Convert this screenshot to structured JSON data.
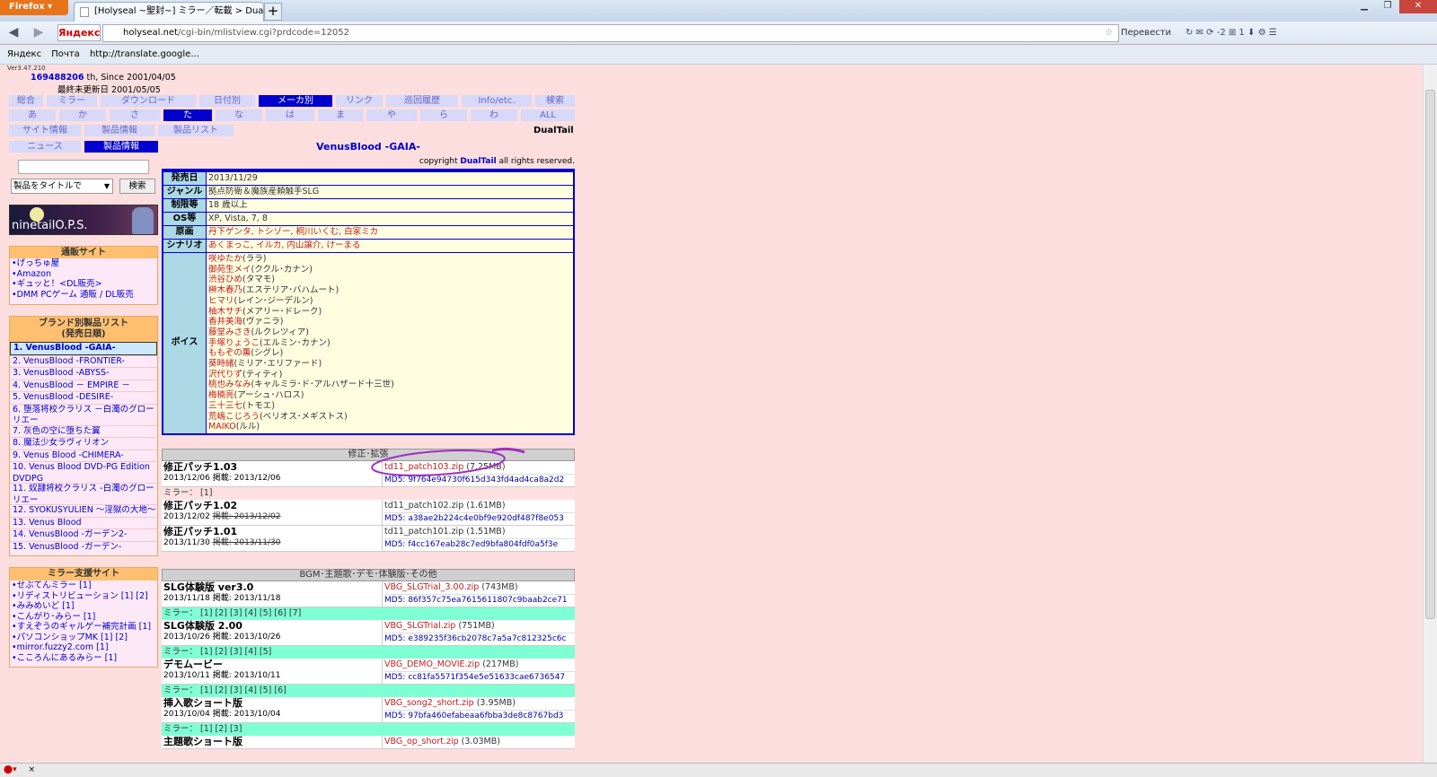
{
  "browser": {
    "app_button": "Firefox",
    "tab_title": "[Holyseal ~聖封~] ミラー／転載 > Dual...",
    "new_tab": "+",
    "yandex_button": "Яндекс",
    "url_domain": "holyseal.net",
    "url_path": "/cgi-bin/mlistview.cgi?prdcode=12052",
    "translate_label": "Перевести",
    "toolbar_counts": "⟳ -2  ⊞ 1",
    "bookmarks": [
      "Яндекс",
      "Почта",
      "http://translate.google..."
    ],
    "status_close": "×"
  },
  "page": {
    "version": "Ver3.47.210",
    "counter": "169488206",
    "counter_suffix": "th, Since 2001/04/05",
    "last_update": "最終未更新日 2001/05/05"
  },
  "menus": {
    "row1": [
      "総合",
      "ミラー",
      "ダウンロード",
      "日付別",
      "メーカ別",
      "リンク",
      "巡回履歴",
      "Info/etc.",
      "検索"
    ],
    "row2": [
      "あ",
      "か",
      "さ",
      "た",
      "な",
      "は",
      "ま",
      "や",
      "ら",
      "わ",
      "ALL"
    ],
    "row3": [
      "サイト情報",
      "製品情報",
      "製品リスト"
    ],
    "row4": [
      "ニュース",
      "製品情報"
    ]
  },
  "brand_name": "DualTail",
  "search": {
    "select_value": "製品をタイトルで",
    "button": "検索"
  },
  "banner_text": "ninetailO.P.S.",
  "shops": {
    "title": "通販サイト",
    "items": [
      "•げっちゅ屋",
      "•Amazon",
      "•ギュッと！<DL販売>",
      "•DMM PCゲーム 通販 / DL販売"
    ]
  },
  "brandlist": {
    "title": "ブランド別製品リスト",
    "subtitle": "(発売日順)",
    "items": [
      "1. VenusBlood -GAIA-",
      "2. VenusBlood -FRONTIER-",
      "3. VenusBlood -ABYSS-",
      "4. VenusBlood － EMPIRE －",
      "5. VenusBlood -DESIRE-",
      "6. 堕落将校クラリス －白濁のグローリエー",
      "7. 灰色の空に堕ちた翼",
      "8. 魔法少女ラヴィリオン",
      "9. Venus Blood -CHIMERA-",
      "10. Venus Blood DVD-PG Edition DVDPG",
      "11. 奴隷将校クラリス -白濁のグローリエー",
      "12. SYOKUSYULIEN ～淫獄の大地～",
      "13. Venus Blood",
      "14. VenusBlood -ガーデン2-",
      "15. VenusBlood -ガーデン-"
    ]
  },
  "mirrorsites": {
    "title": "ミラー支援サイト",
    "items": [
      "•せぶてんミラー [1]",
      "•リディストリビューション [1] [2]",
      "•みみめいど [1]",
      "•こんがり･みらー [1]",
      "•すえぞうのギャルゲー補完計画 [1]",
      "•パソコンショップMK [1] [2]",
      "•mirror.fuzzy2.com [1]",
      "•こころんにあるみらー [1]"
    ]
  },
  "product": {
    "title": "VenusBlood -GAIA-",
    "copyright_pre": "copyright ",
    "copyright_brand": "DualTail",
    "copyright_post": " all rights reserved.",
    "rows": [
      {
        "label": "発売日",
        "value": "2013/11/29"
      },
      {
        "label": "ジャンル",
        "value": "拠点防衛＆魔族産頼触手SLG"
      },
      {
        "label": "制限等",
        "value": "18 歳以上"
      },
      {
        "label": "OS等",
        "value": "XP, Vista, 7, 8"
      },
      {
        "label": "原画",
        "value": "丹下ゲンタ, トシゾー, 桐川いくむ, 白家ミカ"
      },
      {
        "label": "シナリオ",
        "value": "あくまっこ, イルカ, 内山譲介, けーまる"
      }
    ],
    "voice_label": "ボイス",
    "voices": [
      [
        "咲ゆたか",
        "(ララ)"
      ],
      [
        "御苑生メイ",
        "(ククル･カナン)"
      ],
      [
        "渋谷ひめ",
        "(タマモ)"
      ],
      [
        "榊木春乃",
        "(エステリア･バハムート)"
      ],
      [
        "ヒマリ",
        "(レイン･ジーデルン)"
      ],
      [
        "柚木サチ",
        "(メアリー･ドレーク)"
      ],
      [
        "香井美海",
        "(ヴァニラ)"
      ],
      [
        "藤堂みさき",
        "(ルクレツィア)"
      ],
      [
        "手塚りょうこ",
        "(エルミン･カナン)"
      ],
      [
        "ももぞの薫",
        "(シグレ)"
      ],
      [
        "葵時緒",
        "(ミリア･エリファード)"
      ],
      [
        "沢代りず",
        "(ティティ)"
      ],
      [
        "桃也みなみ",
        "(キャルミラ･ド･アルハザード十三世)"
      ],
      [
        "梅楠亮",
        "(アーシュ･ハロス)"
      ],
      [
        "三十三七",
        "(トモエ)"
      ],
      [
        "荒嶋こじろう",
        "(ベリオス･メギストス)"
      ],
      [
        "MAIKO",
        "(ルル)"
      ]
    ]
  },
  "patches": {
    "title": "修正･拡張",
    "entries": [
      {
        "title": "修正パッチ1.03",
        "date": "2013/12/06 掲載: 2013/12/06",
        "file": "td11_patch103.zip",
        "size": " (7.25MB)",
        "md5": "MD5: 9f764e94730f615d343fd4ad4ca8a2d2"
      },
      {
        "title": "修正パッチ1.02",
        "date": "2013/12/02 ",
        "date_strike": "掲載: 2013/12/02",
        "file": "td11_patch102.zip",
        "size": " (1.61MB)",
        "md5": "MD5: a38ae2b224c4e0bf9e920df487f8e053"
      },
      {
        "title": "修正パッチ1.01",
        "date": "2013/11/30 ",
        "date_strike": "掲載: 2013/11/30",
        "file": "td11_patch101.zip",
        "size": " (1.51MB)",
        "md5": "MD5: f4cc167eab28c7ed9bfa804fdf0a5f3e"
      }
    ],
    "mirror1": "ミラー： [1]"
  },
  "bgm": {
    "title": "BGM･主題歌･デモ･体験版･その他",
    "entries": [
      {
        "title": "SLG体験版 ver3.0",
        "date": "2013/11/18 掲載: 2013/11/18",
        "file": "VBG_SLGTrial_3.00.zip",
        "size": " (743MB)",
        "md5": "MD5: 86f357c75ea7615611807c9baab2ce71",
        "mirror": "ミラー： [1] [2] [3] [4] [5] [6] [7]"
      },
      {
        "title": "SLG体験版 2.00",
        "date": "2013/10/26 掲載: 2013/10/26",
        "file": "VBG_SLGTrial.zip",
        "size": " (751MB)",
        "md5": "MD5: e389235f36cb2078c7a5a7c812325c6c",
        "mirror": "ミラー： [1] [2] [3] [4] [5]"
      },
      {
        "title": "デモムービー",
        "date": "2013/10/11 掲載: 2013/10/11",
        "file": "VBG_DEMO_MOVIE.zip",
        "size": " (217MB)",
        "md5": "MD5: cc81fa5571f354e5e51633cae6736547",
        "mirror": "ミラー： [1] [2] [3] [4] [5] [6]"
      },
      {
        "title": "挿入歌ショート版",
        "date": "2013/10/04 掲載: 2013/10/04",
        "file": "VBG_song2_short.zip",
        "size": " (3.95MB)",
        "md5": "MD5: 97bfa460efabeaa6fbba3de8c8767bd3",
        "mirror": "ミラー： [1] [2] [3]"
      },
      {
        "title": "主題歌ショート版",
        "file": "VBG_op_short.zip",
        "size": " (3.03MB)"
      }
    ]
  }
}
